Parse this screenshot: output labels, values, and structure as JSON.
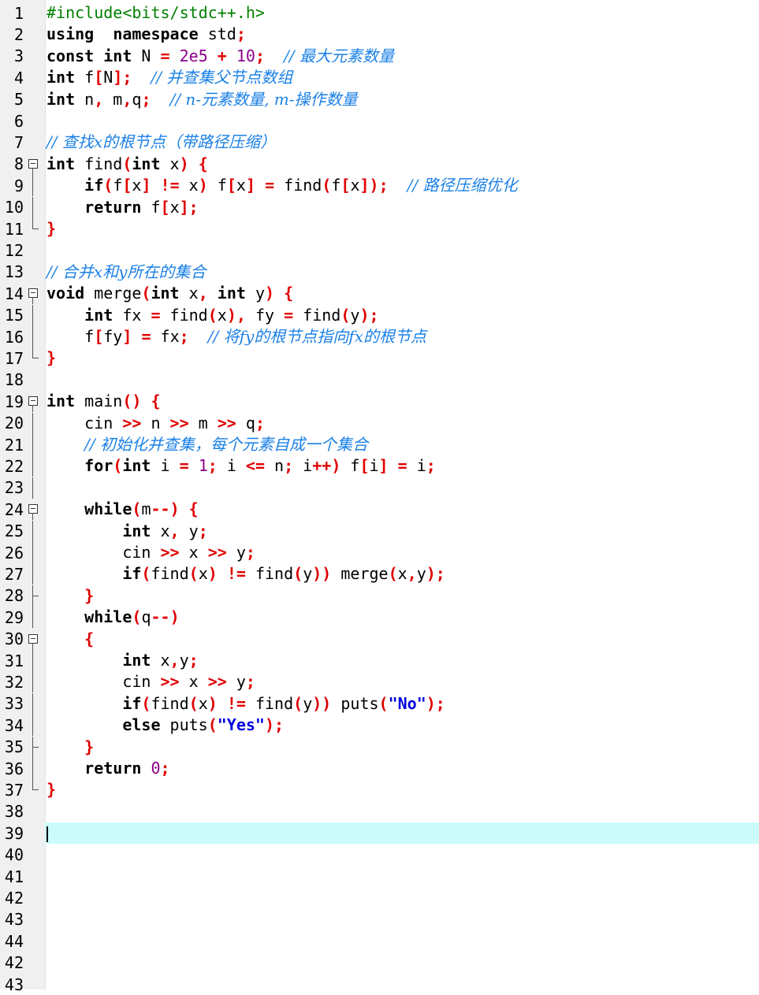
{
  "editor": {
    "language": "C++",
    "current_line": 39,
    "colors": {
      "keyword": "#000000",
      "preprocessor": "#008000",
      "number": "#8a008a",
      "operator": "#e00000",
      "string": "#0000e0",
      "comment": "#1a80e6",
      "current_line_bg": "#ccfbfb",
      "gutter_bg": "#f0f0f0"
    },
    "lines": [
      {
        "n": "1",
        "fold": "none",
        "tokens": [
          [
            "pp",
            "#include<bits/stdc++.h>"
          ]
        ]
      },
      {
        "n": "2",
        "fold": "none",
        "tokens": [
          [
            "kw",
            "using"
          ],
          [
            "",
            "  "
          ],
          [
            "kw",
            "namespace"
          ],
          [
            "",
            " std"
          ],
          [
            "op",
            ";"
          ]
        ]
      },
      {
        "n": "3",
        "fold": "none",
        "tokens": [
          [
            "kw",
            "const"
          ],
          [
            "",
            " "
          ],
          [
            "kw",
            "int"
          ],
          [
            "",
            " N "
          ],
          [
            "op",
            "="
          ],
          [
            "",
            " "
          ],
          [
            "num",
            "2e5"
          ],
          [
            "",
            " "
          ],
          [
            "op",
            "+"
          ],
          [
            "",
            " "
          ],
          [
            "num",
            "10"
          ],
          [
            "op",
            ";"
          ],
          [
            "",
            "  "
          ],
          [
            "cm",
            "// 最大元素数量"
          ]
        ]
      },
      {
        "n": "4",
        "fold": "none",
        "tokens": [
          [
            "kw",
            "int"
          ],
          [
            "",
            " f"
          ],
          [
            "op",
            "["
          ],
          [
            "",
            "N"
          ],
          [
            "op",
            "];"
          ],
          [
            "",
            "  "
          ],
          [
            "cm",
            "// 并查集父节点数组"
          ]
        ]
      },
      {
        "n": "5",
        "fold": "none",
        "tokens": [
          [
            "kw",
            "int"
          ],
          [
            "",
            " n"
          ],
          [
            "op",
            ","
          ],
          [
            "",
            " m"
          ],
          [
            "op",
            ","
          ],
          [
            "",
            "q"
          ],
          [
            "op",
            ";"
          ],
          [
            "",
            "  "
          ],
          [
            "cm",
            "// n-元素数量, m-操作数量"
          ]
        ]
      },
      {
        "n": "6",
        "fold": "none",
        "tokens": []
      },
      {
        "n": "7",
        "fold": "none",
        "tokens": [
          [
            "cm",
            "// 查找x的根节点（带路径压缩）"
          ]
        ]
      },
      {
        "n": "8",
        "fold": "open",
        "tokens": [
          [
            "kw",
            "int"
          ],
          [
            "",
            " find"
          ],
          [
            "op",
            "("
          ],
          [
            "kw",
            "int"
          ],
          [
            "",
            " x"
          ],
          [
            "op",
            ")"
          ],
          [
            "",
            " "
          ],
          [
            "op",
            "{"
          ]
        ]
      },
      {
        "n": "9",
        "fold": "line",
        "tokens": [
          [
            "",
            "    "
          ],
          [
            "kw",
            "if"
          ],
          [
            "op",
            "("
          ],
          [
            "",
            "f"
          ],
          [
            "op",
            "["
          ],
          [
            "",
            "x"
          ],
          [
            "op",
            "]"
          ],
          [
            "",
            " "
          ],
          [
            "op",
            "!="
          ],
          [
            "",
            " x"
          ],
          [
            "op",
            ")"
          ],
          [
            "",
            " f"
          ],
          [
            "op",
            "["
          ],
          [
            "",
            "x"
          ],
          [
            "op",
            "]"
          ],
          [
            "",
            " "
          ],
          [
            "op",
            "="
          ],
          [
            "",
            " find"
          ],
          [
            "op",
            "("
          ],
          [
            "",
            "f"
          ],
          [
            "op",
            "["
          ],
          [
            "",
            "x"
          ],
          [
            "op",
            "]);"
          ],
          [
            "",
            "  "
          ],
          [
            "cm",
            "// 路径压缩优化"
          ]
        ]
      },
      {
        "n": "10",
        "fold": "line",
        "tokens": [
          [
            "",
            "    "
          ],
          [
            "kw",
            "return"
          ],
          [
            "",
            " f"
          ],
          [
            "op",
            "["
          ],
          [
            "",
            "x"
          ],
          [
            "op",
            "];"
          ]
        ]
      },
      {
        "n": "11",
        "fold": "end",
        "tokens": [
          [
            "op",
            "}"
          ]
        ]
      },
      {
        "n": "12",
        "fold": "none",
        "tokens": []
      },
      {
        "n": "13",
        "fold": "none",
        "tokens": [
          [
            "cm",
            "// 合并x和y所在的集合"
          ]
        ]
      },
      {
        "n": "14",
        "fold": "open",
        "tokens": [
          [
            "kw",
            "void"
          ],
          [
            "",
            " merge"
          ],
          [
            "op",
            "("
          ],
          [
            "kw",
            "int"
          ],
          [
            "",
            " x"
          ],
          [
            "op",
            ","
          ],
          [
            "",
            " "
          ],
          [
            "kw",
            "int"
          ],
          [
            "",
            " y"
          ],
          [
            "op",
            ")"
          ],
          [
            "",
            " "
          ],
          [
            "op",
            "{"
          ]
        ]
      },
      {
        "n": "15",
        "fold": "line",
        "tokens": [
          [
            "",
            "    "
          ],
          [
            "kw",
            "int"
          ],
          [
            "",
            " fx "
          ],
          [
            "op",
            "="
          ],
          [
            "",
            " find"
          ],
          [
            "op",
            "("
          ],
          [
            "",
            "x"
          ],
          [
            "op",
            "),"
          ],
          [
            "",
            " fy "
          ],
          [
            "op",
            "="
          ],
          [
            "",
            " find"
          ],
          [
            "op",
            "("
          ],
          [
            "",
            "y"
          ],
          [
            "op",
            ");"
          ]
        ]
      },
      {
        "n": "16",
        "fold": "line",
        "tokens": [
          [
            "",
            "    f"
          ],
          [
            "op",
            "["
          ],
          [
            "",
            "fy"
          ],
          [
            "op",
            "]"
          ],
          [
            "",
            " "
          ],
          [
            "op",
            "="
          ],
          [
            "",
            " fx"
          ],
          [
            "op",
            ";"
          ],
          [
            "",
            "  "
          ],
          [
            "cm",
            "// 将fy的根节点指向fx的根节点"
          ]
        ]
      },
      {
        "n": "17",
        "fold": "end",
        "tokens": [
          [
            "op",
            "}"
          ]
        ]
      },
      {
        "n": "18",
        "fold": "none",
        "tokens": []
      },
      {
        "n": "19",
        "fold": "open",
        "tokens": [
          [
            "kw",
            "int"
          ],
          [
            "",
            " main"
          ],
          [
            "op",
            "()"
          ],
          [
            "",
            " "
          ],
          [
            "op",
            "{"
          ]
        ]
      },
      {
        "n": "20",
        "fold": "line",
        "tokens": [
          [
            "",
            "    cin "
          ],
          [
            "op",
            ">>"
          ],
          [
            "",
            " n "
          ],
          [
            "op",
            ">>"
          ],
          [
            "",
            " m "
          ],
          [
            "op",
            ">>"
          ],
          [
            "",
            " q"
          ],
          [
            "op",
            ";"
          ]
        ]
      },
      {
        "n": "21",
        "fold": "line",
        "tokens": [
          [
            "",
            "    "
          ],
          [
            "cm",
            "// 初始化并查集，每个元素自成一个集合"
          ]
        ]
      },
      {
        "n": "22",
        "fold": "line",
        "tokens": [
          [
            "",
            "    "
          ],
          [
            "kw",
            "for"
          ],
          [
            "op",
            "("
          ],
          [
            "kw",
            "int"
          ],
          [
            "",
            " i "
          ],
          [
            "op",
            "="
          ],
          [
            "",
            " "
          ],
          [
            "num",
            "1"
          ],
          [
            "op",
            ";"
          ],
          [
            "",
            " i "
          ],
          [
            "op",
            "<="
          ],
          [
            "",
            " n"
          ],
          [
            "op",
            ";"
          ],
          [
            "",
            " i"
          ],
          [
            "op",
            "++)"
          ],
          [
            "",
            " f"
          ],
          [
            "op",
            "["
          ],
          [
            "",
            "i"
          ],
          [
            "op",
            "]"
          ],
          [
            "",
            " "
          ],
          [
            "op",
            "="
          ],
          [
            "",
            " i"
          ],
          [
            "op",
            ";"
          ]
        ]
      },
      {
        "n": "23",
        "fold": "line",
        "tokens": []
      },
      {
        "n": "24",
        "fold": "open2",
        "tokens": [
          [
            "",
            "    "
          ],
          [
            "kw",
            "while"
          ],
          [
            "op",
            "("
          ],
          [
            "",
            "m"
          ],
          [
            "op",
            "--)"
          ],
          [
            "",
            " "
          ],
          [
            "op",
            "{"
          ]
        ]
      },
      {
        "n": "25",
        "fold": "line",
        "tokens": [
          [
            "",
            "        "
          ],
          [
            "kw",
            "int"
          ],
          [
            "",
            " x"
          ],
          [
            "op",
            ","
          ],
          [
            "",
            " y"
          ],
          [
            "op",
            ";"
          ]
        ]
      },
      {
        "n": "26",
        "fold": "line",
        "tokens": [
          [
            "",
            "        cin "
          ],
          [
            "op",
            ">>"
          ],
          [
            "",
            " x "
          ],
          [
            "op",
            ">>"
          ],
          [
            "",
            " y"
          ],
          [
            "op",
            ";"
          ]
        ]
      },
      {
        "n": "27",
        "fold": "line",
        "tokens": [
          [
            "",
            "        "
          ],
          [
            "kw",
            "if"
          ],
          [
            "op",
            "("
          ],
          [
            "",
            "find"
          ],
          [
            "op",
            "("
          ],
          [
            "",
            "x"
          ],
          [
            "op",
            ")"
          ],
          [
            "",
            " "
          ],
          [
            "op",
            "!="
          ],
          [
            "",
            " find"
          ],
          [
            "op",
            "("
          ],
          [
            "",
            "y"
          ],
          [
            "op",
            "))"
          ],
          [
            "",
            " merge"
          ],
          [
            "op",
            "("
          ],
          [
            "",
            "x"
          ],
          [
            "op",
            ","
          ],
          [
            "",
            "y"
          ],
          [
            "op",
            ");"
          ]
        ]
      },
      {
        "n": "28",
        "fold": "tee",
        "tokens": [
          [
            "",
            "    "
          ],
          [
            "op",
            "}"
          ]
        ]
      },
      {
        "n": "29",
        "fold": "line",
        "tokens": [
          [
            "",
            "    "
          ],
          [
            "kw",
            "while"
          ],
          [
            "op",
            "("
          ],
          [
            "",
            "q"
          ],
          [
            "op",
            "--)"
          ]
        ]
      },
      {
        "n": "30",
        "fold": "open2",
        "tokens": [
          [
            "",
            "    "
          ],
          [
            "op",
            "{"
          ]
        ]
      },
      {
        "n": "31",
        "fold": "line",
        "tokens": [
          [
            "",
            "        "
          ],
          [
            "kw",
            "int"
          ],
          [
            "",
            " x"
          ],
          [
            "op",
            ","
          ],
          [
            "",
            "y"
          ],
          [
            "op",
            ";"
          ]
        ]
      },
      {
        "n": "32",
        "fold": "line",
        "tokens": [
          [
            "",
            "        cin "
          ],
          [
            "op",
            ">>"
          ],
          [
            "",
            " x "
          ],
          [
            "op",
            ">>"
          ],
          [
            "",
            " y"
          ],
          [
            "op",
            ";"
          ]
        ]
      },
      {
        "n": "33",
        "fold": "line",
        "tokens": [
          [
            "",
            "        "
          ],
          [
            "kw",
            "if"
          ],
          [
            "op",
            "("
          ],
          [
            "",
            "find"
          ],
          [
            "op",
            "("
          ],
          [
            "",
            "x"
          ],
          [
            "op",
            ")"
          ],
          [
            "",
            " "
          ],
          [
            "op",
            "!="
          ],
          [
            "",
            " find"
          ],
          [
            "op",
            "("
          ],
          [
            "",
            "y"
          ],
          [
            "op",
            "))"
          ],
          [
            "",
            " puts"
          ],
          [
            "op",
            "("
          ],
          [
            "str",
            "\"No\""
          ],
          [
            "op",
            ");"
          ]
        ]
      },
      {
        "n": "34",
        "fold": "line",
        "tokens": [
          [
            "",
            "        "
          ],
          [
            "kw",
            "else"
          ],
          [
            "",
            " puts"
          ],
          [
            "op",
            "("
          ],
          [
            "str",
            "\"Yes\""
          ],
          [
            "op",
            ");"
          ]
        ]
      },
      {
        "n": "35",
        "fold": "tee",
        "tokens": [
          [
            "",
            "    "
          ],
          [
            "op",
            "}"
          ]
        ]
      },
      {
        "n": "36",
        "fold": "line",
        "tokens": [
          [
            "",
            "    "
          ],
          [
            "kw",
            "return"
          ],
          [
            "",
            " "
          ],
          [
            "num",
            "0"
          ],
          [
            "op",
            ";"
          ]
        ]
      },
      {
        "n": "37",
        "fold": "end",
        "tokens": [
          [
            "op",
            "}"
          ]
        ]
      },
      {
        "n": "38",
        "fold": "none",
        "tokens": []
      },
      {
        "n": "39",
        "fold": "none",
        "tokens": [],
        "current": true
      },
      {
        "n": "40",
        "fold": "none",
        "tokens": []
      },
      {
        "n": "41",
        "fold": "none",
        "tokens": []
      },
      {
        "n": "42",
        "fold": "none",
        "tokens": []
      },
      {
        "n": "43",
        "fold": "none",
        "tokens": []
      },
      {
        "n": "44",
        "fold": "none",
        "tokens": []
      },
      {
        "n": "42",
        "fold": "none",
        "tokens": []
      },
      {
        "n": "43",
        "fold": "none",
        "tokens": []
      }
    ]
  }
}
